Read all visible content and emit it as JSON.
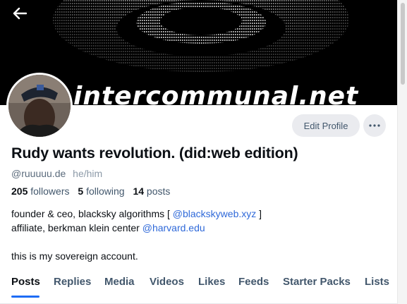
{
  "banner": {
    "text": "intercommunal.net"
  },
  "profile": {
    "display_name": "Rudy wants revolution. (did:web edition)",
    "handle": "@ruuuuu.de",
    "pronouns": "he/him",
    "followers_count": "205",
    "followers_label": "followers",
    "following_count": "5",
    "following_label": "following",
    "posts_count": "14",
    "posts_label": "posts"
  },
  "actions": {
    "edit_profile_label": "Edit Profile"
  },
  "bio": {
    "line1_prefix": "founder & ceo, blacksky algorithms [ ",
    "line1_link": "@blackskyweb.xyz",
    "line1_suffix": " ]",
    "line2_prefix": "affiliate, berkman klein center ",
    "line2_link": "@harvard.edu",
    "line3": "this is my sovereign account."
  },
  "tabs": [
    {
      "label": "Posts"
    },
    {
      "label": "Replies"
    },
    {
      "label": "Media"
    },
    {
      "label": "Videos"
    },
    {
      "label": "Likes"
    },
    {
      "label": "Feeds"
    },
    {
      "label": "Starter Packs"
    },
    {
      "label": "Lists"
    }
  ],
  "colors": {
    "accent": "#1e6cf5",
    "link": "#2f69d9",
    "button_bg": "#eaebef"
  },
  "icons": {
    "back": "arrow-left-icon",
    "more": "ellipsis-icon"
  }
}
